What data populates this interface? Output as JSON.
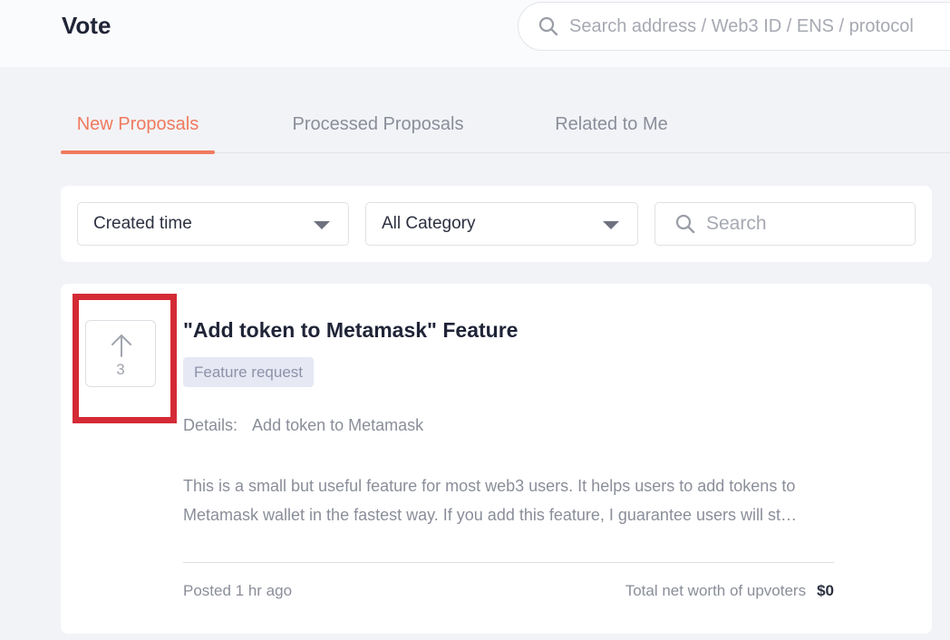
{
  "header": {
    "title": "Vote",
    "search": {
      "placeholder": "Search address / Web3 ID / ENS / protocol",
      "value": ""
    }
  },
  "tabs": [
    {
      "label": "New Proposals",
      "active": true
    },
    {
      "label": "Processed Proposals",
      "active": false
    },
    {
      "label": "Related to Me",
      "active": false
    }
  ],
  "filters": {
    "sort": {
      "selected": "Created time"
    },
    "category": {
      "selected": "All Category"
    },
    "search": {
      "placeholder": "Search",
      "value": ""
    }
  },
  "proposal": {
    "vote_count": "3",
    "title": "\"Add token to Metamask\" Feature",
    "tag": "Feature request",
    "details_label": "Details:",
    "details_value": "Add token to Metamask",
    "description": "This is a small but useful feature for most web3 users. It helps users to add tokens to Metamask wallet in the fastest way. If you add this feature, I guarantee users will st…",
    "posted": "Posted 1 hr ago",
    "networth_label": "Total net worth of upvoters",
    "networth_value": "$0"
  },
  "colors": {
    "accent": "#ef7a5e",
    "highlight": "#d42a36",
    "tag_bg": "#e6e8f4"
  },
  "icons": {
    "search": "search-icon",
    "upvote": "arrow-up-icon",
    "dropdown": "caret-down-icon"
  }
}
